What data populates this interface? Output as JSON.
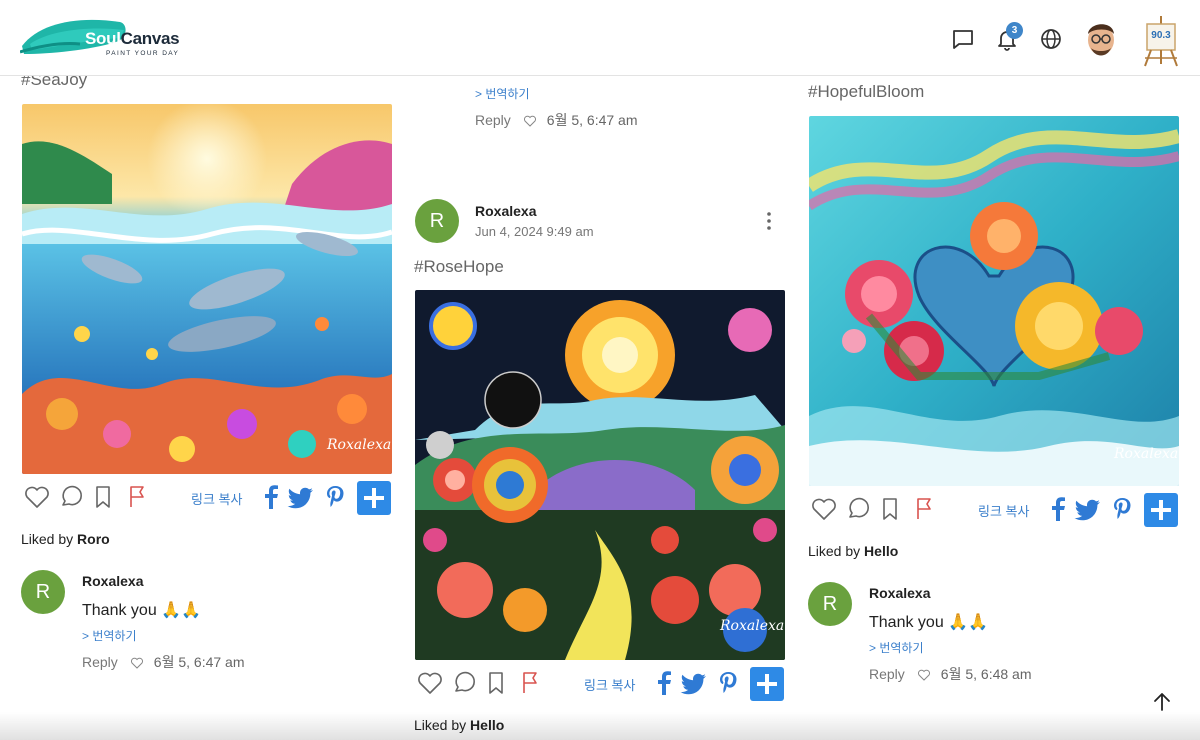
{
  "header": {
    "brand_part1": "Soul",
    "brand_part2": "Canvas",
    "tagline": "PAINT YOUR DAY",
    "notification_count": "3",
    "points": "90.3"
  },
  "posts": [
    {
      "tag": "#SeaJoy",
      "copy_link_label": "링크 복사",
      "liked_prefix": "Liked by ",
      "liked_user": "Roro",
      "comment": {
        "initial": "R",
        "author": "Roxalexa",
        "text": "Thank you 🙏🙏",
        "translate": "> 번역하기",
        "reply": "Reply",
        "date": "6월 5, 6:47 am"
      },
      "signature": "Roxalexa"
    },
    {
      "prev_translate": "> 번역하기",
      "prev_reply": "Reply",
      "prev_date": "6월 5, 6:47 am",
      "author_initial": "R",
      "author": "Roxalexa",
      "posted": "Jun 4, 2024 9:49 am",
      "tag": "#RoseHope",
      "copy_link_label": "링크 복사",
      "liked_prefix": "Liked by ",
      "liked_user": "Hello",
      "signature": "Roxalexa"
    },
    {
      "tag": "#HopefulBloom",
      "copy_link_label": "링크 복사",
      "liked_prefix": "Liked by ",
      "liked_user": "Hello",
      "comment": {
        "initial": "R",
        "author": "Roxalexa",
        "text": "Thank you 🙏🙏",
        "translate": "> 번역하기",
        "reply": "Reply",
        "date": "6월 5, 6:48 am"
      },
      "signature": "Roxalexa"
    }
  ],
  "colors": {
    "accent": "#2e8ae6",
    "link": "#3b7fcb",
    "avatar": "#6aa13e",
    "flag": "#d9534f",
    "badge": "#3f86c9"
  },
  "icons": [
    "chat-icon",
    "bell-icon",
    "globe-icon",
    "heart-icon",
    "comment-icon",
    "bookmark-icon",
    "flag-icon",
    "facebook-icon",
    "twitter-icon",
    "pinterest-icon",
    "plus-icon",
    "arrow-up-icon",
    "more-vertical-icon"
  ]
}
